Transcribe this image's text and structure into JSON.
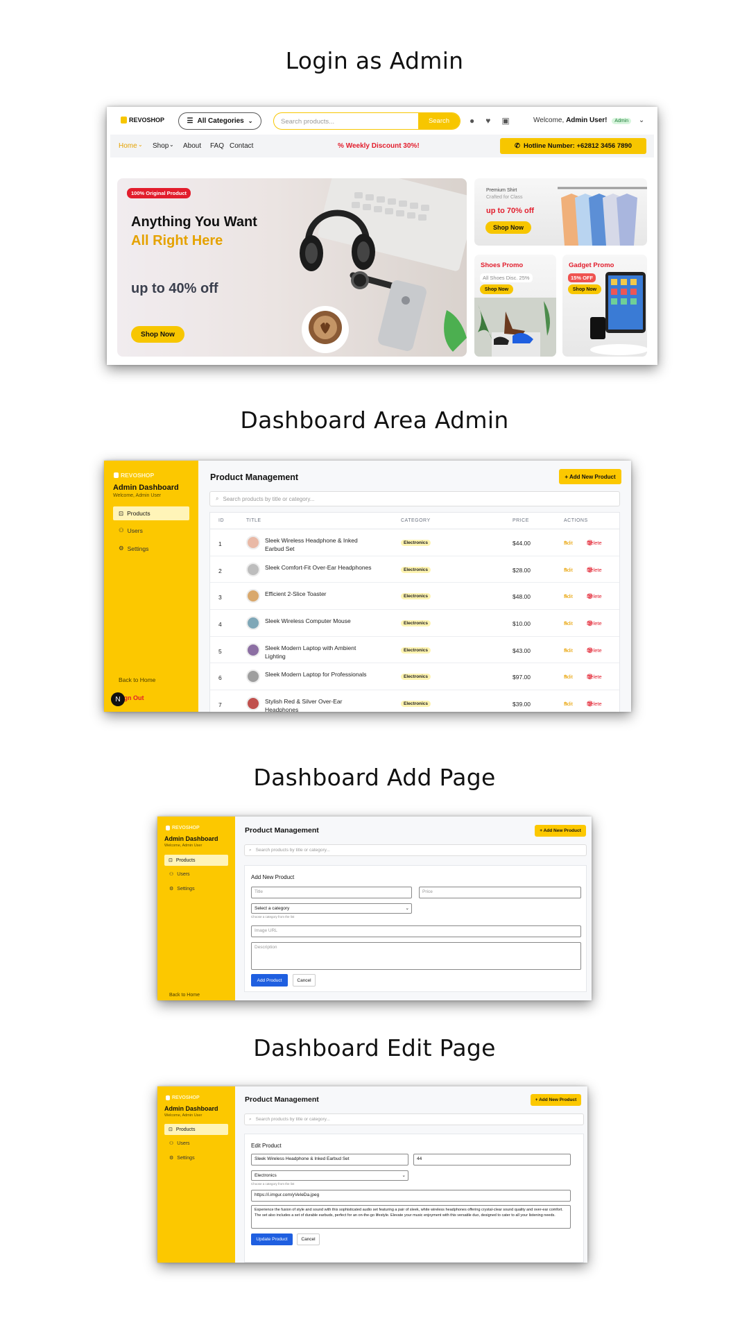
{
  "sections": {
    "login_title": "Login as Admin",
    "dashboard_title": "Dashboard Area Admin",
    "add_title": "Dashboard Add Page",
    "edit_title": "Dashboard Edit Page"
  },
  "store": {
    "logo": "REVOSHOP",
    "categories_label": "All Categories",
    "search_placeholder": "Search products...",
    "search_button": "Search",
    "welcome_prefix": "Welcome,",
    "welcome_user": "Admin User!",
    "admin_badge": "Admin",
    "nav": [
      "Home",
      "Shop",
      "About",
      "FAQ",
      "Contact"
    ],
    "weekly_discount": "Weekly Discount 30%!",
    "hotline": "Hotline Number: +62812 3456 7890",
    "hero": {
      "tag": "100% Original Product",
      "line1": "Anything You Want",
      "line2": "All Right Here",
      "offer": "up to 40% off",
      "button": "Shop Now"
    },
    "promo_shirt": {
      "title": "Premium Shirt",
      "subtitle": "Crafted for Class",
      "offer": "up to 70% off",
      "button": "Shop Now"
    },
    "promo_shoes": {
      "title": "Shoes Promo",
      "badge": "All Shoes Disc. 25%",
      "button": "Shop Now"
    },
    "promo_gadget": {
      "title": "Gadget Promo",
      "badge": "15% OFF",
      "button": "Shop Now"
    }
  },
  "dashboard": {
    "brand": "REVOSHOP",
    "title": "Admin Dashboard",
    "welcome": "Welcome, Admin User",
    "menu": [
      "Products",
      "Users",
      "Settings"
    ],
    "back_home": "Back to Home",
    "sign_out": "Sign Out",
    "avatar_letter": "N",
    "page_title": "Product Management",
    "add_button": "+ Add New Product",
    "search_placeholder": "Search products by title or category...",
    "columns": [
      "ID",
      "TITLE",
      "CATEGORY",
      "PRICE",
      "ACTIONS"
    ],
    "edit_label": "Edit",
    "delete_label": "Delete",
    "rows": [
      {
        "id": "1",
        "title": "Sleek Wireless Headphone & Inked Earbud Set",
        "category": "Electronics",
        "price": "$44.00"
      },
      {
        "id": "2",
        "title": "Sleek Comfort-Fit Over-Ear Headphones",
        "category": "Electronics",
        "price": "$28.00"
      },
      {
        "id": "3",
        "title": "Efficient 2-Slice Toaster",
        "category": "Electronics",
        "price": "$48.00"
      },
      {
        "id": "4",
        "title": "Sleek Wireless Computer Mouse",
        "category": "Electronics",
        "price": "$10.00"
      },
      {
        "id": "5",
        "title": "Sleek Modern Laptop with Ambient Lighting",
        "category": "Electronics",
        "price": "$43.00"
      },
      {
        "id": "6",
        "title": "Sleek Modern Laptop for Professionals",
        "category": "Electronics",
        "price": "$97.00"
      },
      {
        "id": "7",
        "title": "Stylish Red & Silver Over-Ear Headphones",
        "category": "Electronics",
        "price": "$39.00"
      }
    ]
  },
  "add_form": {
    "heading": "Add New Product",
    "title_placeholder": "Title",
    "price_placeholder": "Price",
    "category_placeholder": "Select a category",
    "category_hint": "Choose a category from the list",
    "image_placeholder": "Image URL",
    "description_placeholder": "Description",
    "submit": "Add Product",
    "cancel": "Cancel"
  },
  "edit_form": {
    "heading": "Edit Product",
    "title_value": "Sleek Wireless Headphone & Inked Earbud Set",
    "price_value": "44",
    "category_value": "Electronics",
    "category_hint": "Choose a category from the list",
    "image_value": "https://i.imgur.com/yVeIeDa.jpeg",
    "description_value": "Experience the fusion of style and sound with this sophisticated audio set featuring a pair of sleek, white wireless headphones offering crystal-clear sound quality and over-ear comfort. The set also includes a set of durable earbuds, perfect for an on-the-go lifestyle. Elevate your music enjoyment with this versatile duo, designed to cater to all your listening needs.",
    "submit": "Update Product",
    "cancel": "Cancel"
  },
  "colors": {
    "brand_yellow": "#fcc800",
    "danger_red": "#e21d2c",
    "primary_blue": "#1f5fe0"
  }
}
